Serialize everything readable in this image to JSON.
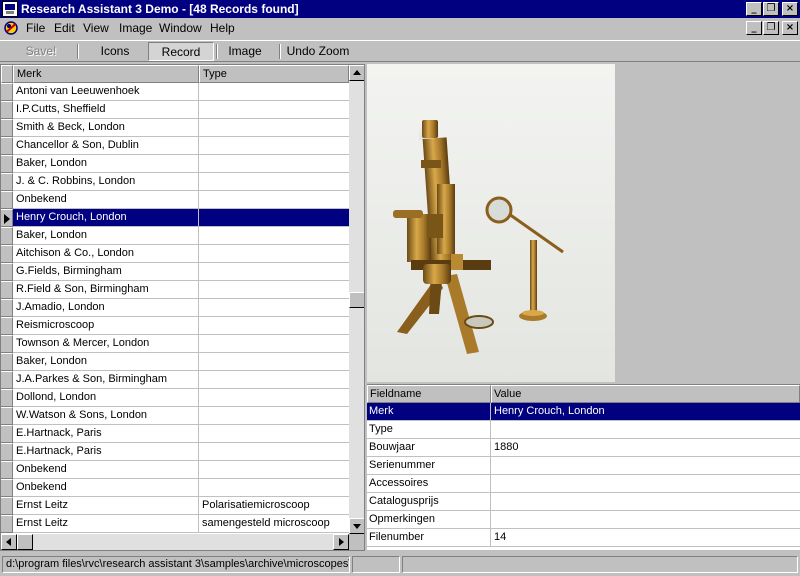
{
  "window": {
    "title": "Research Assistant 3 Demo - [48 Records found]",
    "minimize_glyph": "_",
    "restore_glyph": "❐",
    "close_glyph": "×"
  },
  "menu": {
    "items": [
      {
        "label": "File"
      },
      {
        "label": "Edit"
      },
      {
        "label": "View"
      },
      {
        "label": "Image"
      },
      {
        "label": "Window"
      },
      {
        "label": "Help"
      }
    ]
  },
  "toolbar": {
    "save_label": "Save!",
    "icons_label": "Icons",
    "record_label": "Record",
    "image_label": "Image",
    "undo_zoom_label": "Undo Zoom"
  },
  "records": {
    "columns": [
      "Merk",
      "Type"
    ],
    "rows": [
      {
        "merk": "Antoni van Leeuwenhoek",
        "type": ""
      },
      {
        "merk": "I.P.Cutts, Sheffield",
        "type": ""
      },
      {
        "merk": "Smith & Beck, London",
        "type": ""
      },
      {
        "merk": "Chancellor & Son, Dublin",
        "type": ""
      },
      {
        "merk": "Baker, London",
        "type": ""
      },
      {
        "merk": "J. & C. Robbins, London",
        "type": ""
      },
      {
        "merk": "Onbekend",
        "type": ""
      },
      {
        "merk": "Henry Crouch, London",
        "type": "",
        "selected": true
      },
      {
        "merk": "Baker, London",
        "type": ""
      },
      {
        "merk": "Aitchison & Co., London",
        "type": ""
      },
      {
        "merk": "G.Fields, Birmingham",
        "type": ""
      },
      {
        "merk": "R.Field & Son, Birmingham",
        "type": ""
      },
      {
        "merk": "J.Amadio, London",
        "type": ""
      },
      {
        "merk": "Reismicroscoop",
        "type": ""
      },
      {
        "merk": "Townson & Mercer, London",
        "type": ""
      },
      {
        "merk": "Baker, London",
        "type": ""
      },
      {
        "merk": "J.A.Parkes & Son, Birmingham",
        "type": ""
      },
      {
        "merk": "Dollond, London",
        "type": ""
      },
      {
        "merk": "W.Watson & Sons, London",
        "type": ""
      },
      {
        "merk": "E.Hartnack, Paris",
        "type": ""
      },
      {
        "merk": "E.Hartnack, Paris",
        "type": ""
      },
      {
        "merk": "Onbekend",
        "type": ""
      },
      {
        "merk": "Onbekend",
        "type": ""
      },
      {
        "merk": "Ernst Leitz",
        "type": "Polarisatiemicroscoop"
      },
      {
        "merk": "Ernst Leitz",
        "type": "samengesteld microscoop"
      }
    ]
  },
  "fields": {
    "columns": [
      "Fieldname",
      "Value"
    ],
    "rows": [
      {
        "name": "Merk",
        "value": "Henry Crouch, London",
        "selected": true
      },
      {
        "name": "Type",
        "value": ""
      },
      {
        "name": "Bouwjaar",
        "value": "1880"
      },
      {
        "name": "Serienummer",
        "value": ""
      },
      {
        "name": "Accessoires",
        "value": ""
      },
      {
        "name": "Catalogusprijs",
        "value": ""
      },
      {
        "name": "Opmerkingen",
        "value": ""
      },
      {
        "name": "Filenumber",
        "value": "14"
      }
    ]
  },
  "status": {
    "path": "d:\\program files\\rvc\\research assistant 3\\samples\\archive\\microscopes\\",
    "panel2": "",
    "panel3": ""
  }
}
